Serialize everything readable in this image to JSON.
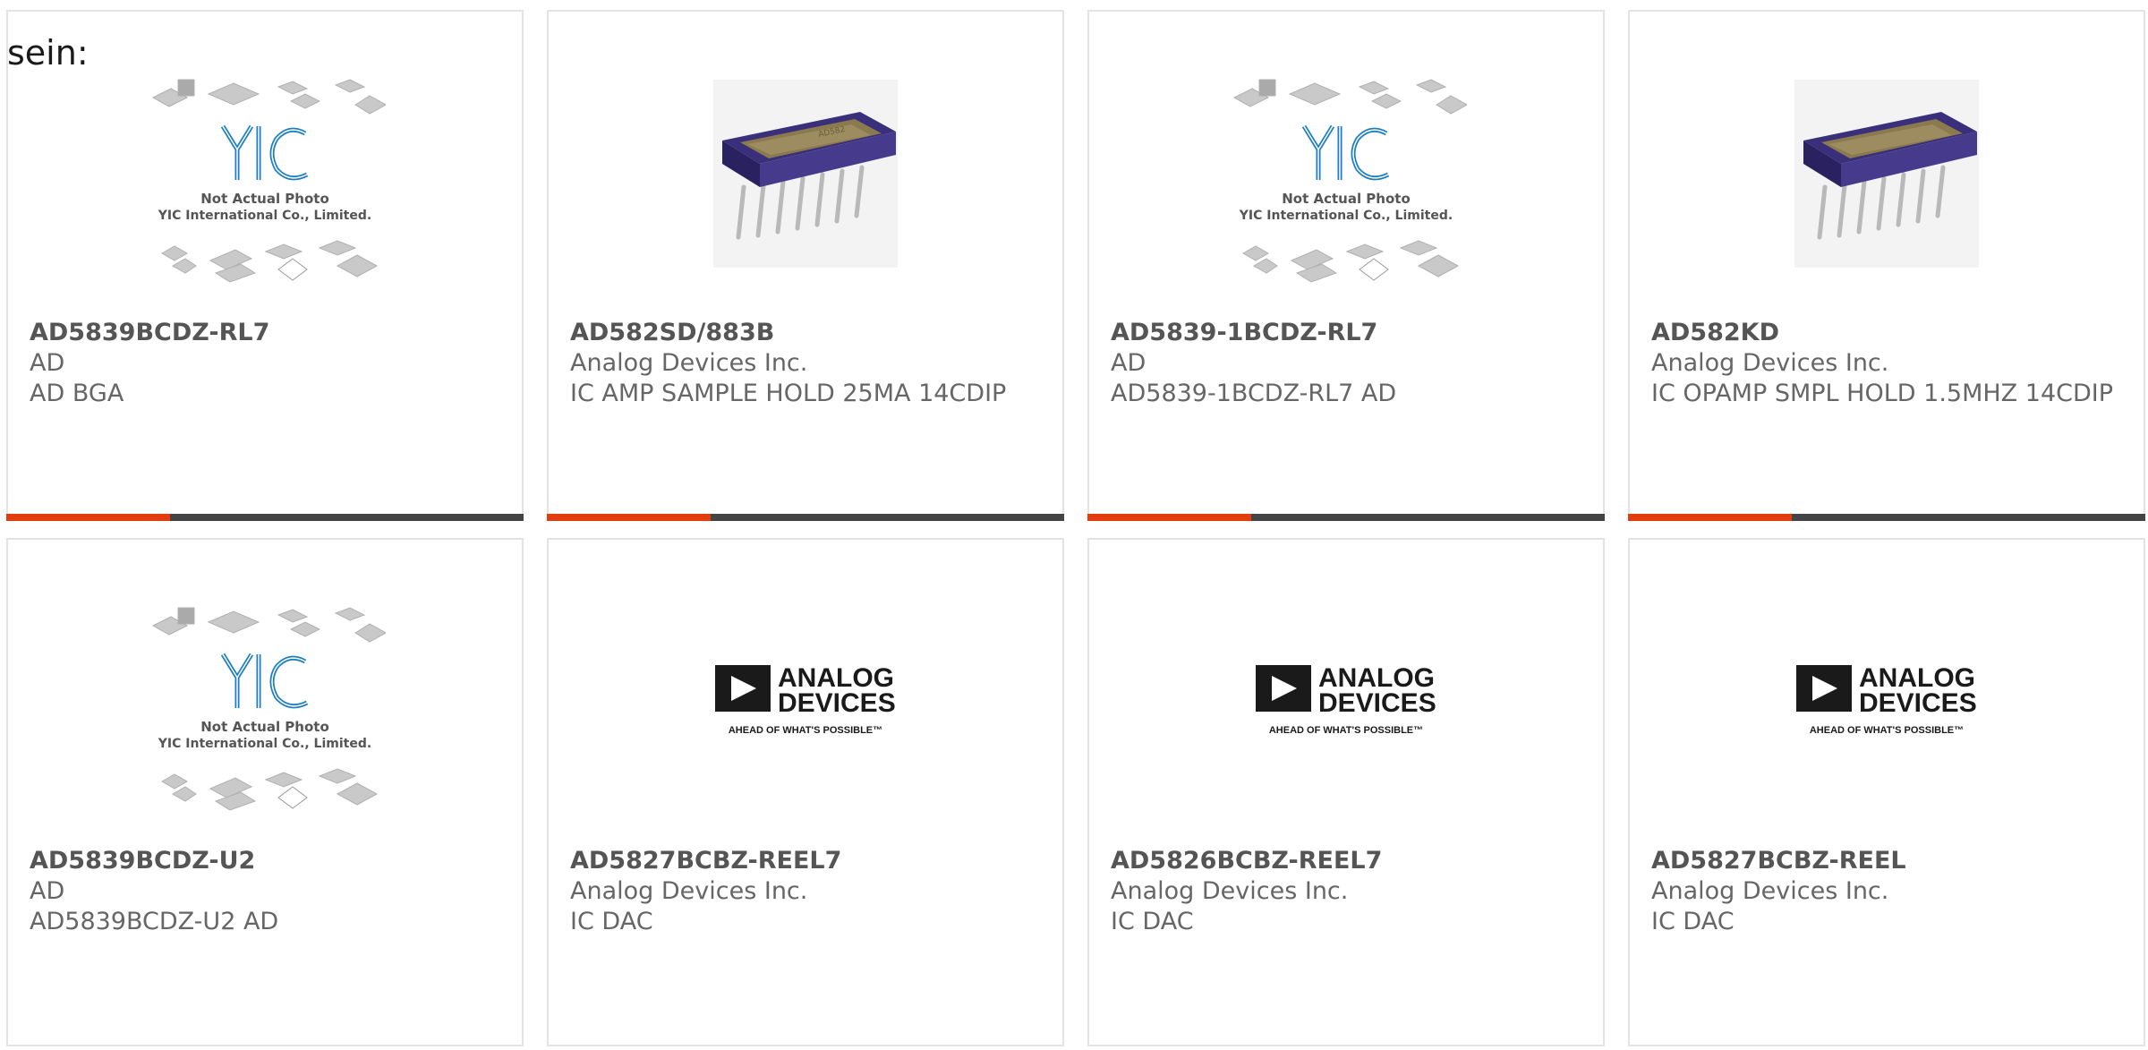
{
  "intro_text": "sein:",
  "products": [
    {
      "part_number": "AD5839BCDZ-RL7",
      "manufacturer": "AD",
      "description": "AD BGA",
      "image": "yic-placeholder",
      "yic_line1": "Not Actual Photo",
      "yic_line2": "YIC International Co., Limited."
    },
    {
      "part_number": "AD582SD/883B",
      "manufacturer": "Analog Devices Inc.",
      "description": "IC AMP SAMPLE HOLD 25MA 14CDIP",
      "image": "dip-chip-photo"
    },
    {
      "part_number": "AD5839-1BCDZ-RL7",
      "manufacturer": "AD",
      "description": "AD5839-1BCDZ-RL7 AD",
      "image": "yic-placeholder",
      "yic_line1": "Not Actual Photo",
      "yic_line2": "YIC International Co., Limited."
    },
    {
      "part_number": "AD582KD",
      "manufacturer": "Analog Devices Inc.",
      "description": "IC OPAMP SMPL HOLD 1.5MHZ 14CDIP",
      "image": "dip-chip-photo"
    },
    {
      "part_number": "AD5839BCDZ-U2",
      "manufacturer": "AD",
      "description": "AD5839BCDZ-U2 AD",
      "image": "yic-placeholder",
      "yic_line1": "Not Actual Photo",
      "yic_line2": "YIC International Co., Limited."
    },
    {
      "part_number": "AD5827BCBZ-REEL7",
      "manufacturer": "Analog Devices Inc.",
      "description": "IC DAC",
      "image": "analog-devices-logo",
      "logo_line1": "ANALOG",
      "logo_line2": "DEVICES",
      "logo_tagline": "AHEAD OF WHAT'S POSSIBLE™"
    },
    {
      "part_number": "AD5826BCBZ-REEL7",
      "manufacturer": "Analog Devices Inc.",
      "description": "IC DAC",
      "image": "analog-devices-logo",
      "logo_line1": "ANALOG",
      "logo_line2": "DEVICES",
      "logo_tagline": "AHEAD OF WHAT'S POSSIBLE™"
    },
    {
      "part_number": "AD5827BCBZ-REEL",
      "manufacturer": "Analog Devices Inc.",
      "description": "IC DAC",
      "image": "analog-devices-logo",
      "logo_line1": "ANALOG",
      "logo_line2": "DEVICES",
      "logo_tagline": "AHEAD OF WHAT'S POSSIBLE™"
    }
  ],
  "colors": {
    "accent_red": "#e23d0e",
    "accent_dark": "#444444",
    "yic_blue": "#1e7fc0",
    "adi_black": "#1a1a1a"
  }
}
